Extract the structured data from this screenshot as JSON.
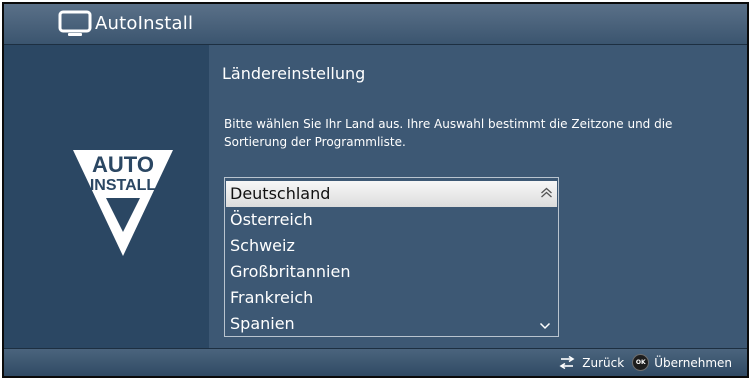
{
  "window": {
    "title": "AutoInstall"
  },
  "main": {
    "heading": "Ländereinstellung",
    "description": "Bitte wählen Sie Ihr Land aus. Ihre Auswahl bestimmt die Zeitzone und die Sortierung der Programmliste."
  },
  "logo": {
    "line1": "AUTO",
    "line2": "INSTALL"
  },
  "country_list": {
    "items": [
      {
        "label": "Deutschland",
        "selected": true
      },
      {
        "label": "Österreich",
        "selected": false
      },
      {
        "label": "Schweiz",
        "selected": false
      },
      {
        "label": "Großbritannien",
        "selected": false
      },
      {
        "label": "Frankreich",
        "selected": false
      },
      {
        "label": "Spanien",
        "selected": false
      }
    ]
  },
  "footer": {
    "back_label": "Zurück",
    "ok_key": "OK",
    "confirm_label": "Übernehmen"
  },
  "icons": {
    "title": "tv-icon",
    "logo": "autoinstall-triangle-icon",
    "scroll_up": "double-chevron-up-icon",
    "scroll_down": "chevron-down-icon",
    "back": "back-arrows-icon",
    "ok": "ok-button-icon"
  },
  "colors": {
    "background": "#2b4763",
    "panel": "#3d5874",
    "selection": "#e8e8e8",
    "text": "#ffffff"
  }
}
